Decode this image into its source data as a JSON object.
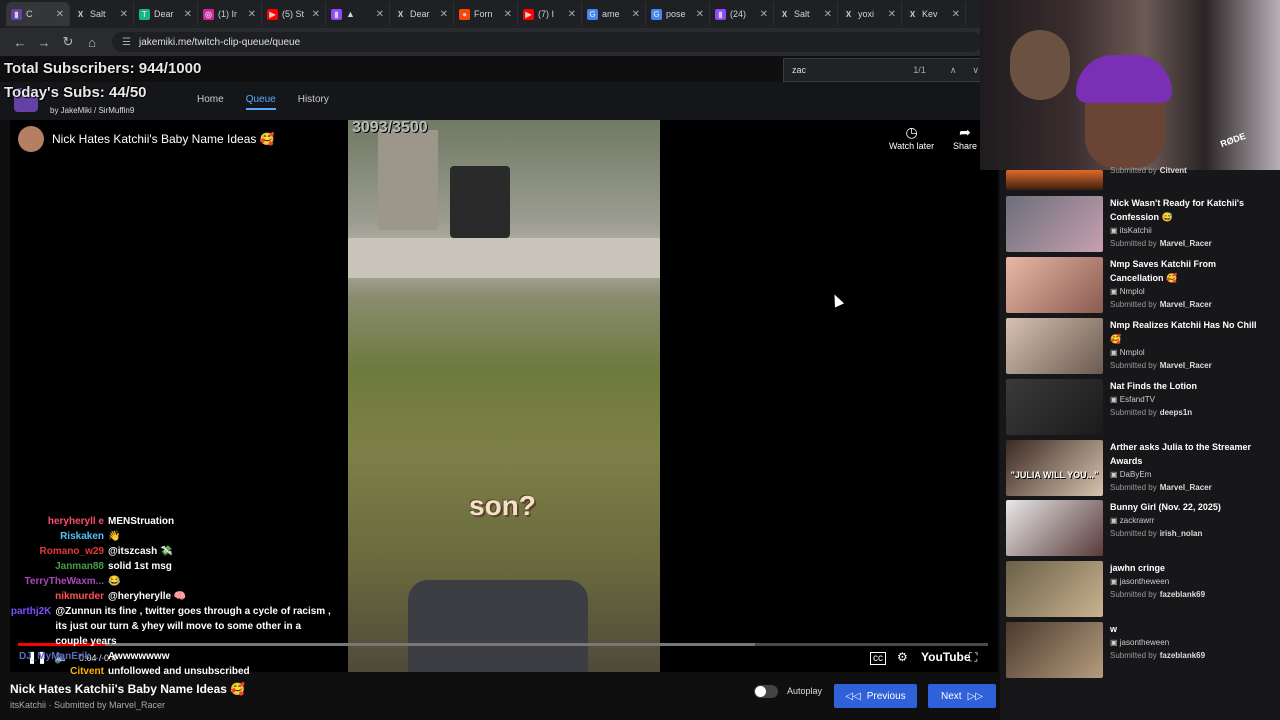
{
  "browser": {
    "tabs": [
      {
        "title": "C",
        "color": "#6441a5",
        "glyph": "▮"
      },
      {
        "title": "Salt",
        "color": "#222",
        "glyph": "X"
      },
      {
        "title": "Dear",
        "color": "#18b585",
        "glyph": "T"
      },
      {
        "title": "(1) Ir",
        "color": "#d6249f",
        "glyph": "◎"
      },
      {
        "title": "(5) St",
        "color": "#ff0000",
        "glyph": "▶"
      },
      {
        "title": "▲",
        "color": "#9146ff",
        "glyph": "▮"
      },
      {
        "title": "Dear",
        "color": "#222",
        "glyph": "X"
      },
      {
        "title": "Forn",
        "color": "#ff4500",
        "glyph": "●"
      },
      {
        "title": "(7) I",
        "color": "#ff0000",
        "glyph": "▶"
      },
      {
        "title": "ame",
        "color": "#4285f4",
        "glyph": "G"
      },
      {
        "title": "pose",
        "color": "#4285f4",
        "glyph": "G"
      },
      {
        "title": "(24)",
        "color": "#9146ff",
        "glyph": "▮"
      },
      {
        "title": "Salt",
        "color": "#222",
        "glyph": "X"
      },
      {
        "title": "yoxi",
        "color": "#222",
        "glyph": "X"
      },
      {
        "title": "Kev",
        "color": "#222",
        "glyph": "X"
      }
    ],
    "url": "jakemiki.me/twitch-clip-queue/queue",
    "find": {
      "query": "zac",
      "count": "1/1"
    }
  },
  "overlay": {
    "total_subs": "Total Subscribers: 944/1000",
    "today_subs": "Today's Subs: 44/50",
    "bits_counter": "3093/3500"
  },
  "site": {
    "credits": "by JakeMiki / SirMuffin9",
    "nav": [
      "Home",
      "Queue",
      "History"
    ],
    "active_nav": "Queue"
  },
  "player": {
    "title": "Nick Hates Katchii's Baby Name Ideas 🥰",
    "watch_later": "Watch later",
    "share": "Share",
    "caption": "son?",
    "time": "0:04 / 0:4",
    "brand": "YouTube",
    "progress_fraction": 0.09
  },
  "chat": [
    {
      "user": "heryheryll e",
      "color": "#ff4d6d",
      "msg": "MENStruation"
    },
    {
      "user": "Riskaken",
      "color": "#4fc3f7",
      "msg": "👋"
    },
    {
      "user": "Romano_w29",
      "color": "#e53935",
      "msg": "@itszcash 💸"
    },
    {
      "user": "Janman88",
      "color": "#43a047",
      "msg": "solid 1st msg"
    },
    {
      "user": "TerryTheWaxm...",
      "color": "#ab47bc",
      "msg": "😂"
    },
    {
      "user": "nikmurder",
      "color": "#ff5252",
      "msg": "@heryherylle 🧠"
    },
    {
      "user": "parthj2K",
      "color": "#7c4dff",
      "msg": "@Zunnun its fine , twitter goes through a cycle of racism , its just our turn & yhey will move to some other in a couple years"
    },
    {
      "user": "DJ_MyManErik_...",
      "color": "#5c6bc0",
      "msg": "Awwwwwww"
    },
    {
      "user": "Citvent",
      "color": "#ffb300",
      "msg": "unfollowed and unsubscribed"
    }
  ],
  "bottom": {
    "title": "Nick Hates Katchii's Baby Name Ideas 🥰",
    "sub": "itsKatchii · Submitted by Marvel_Racer",
    "autoplay": "Autoplay",
    "previous": "Previous",
    "next": "Next"
  },
  "queue": [
    {
      "title": "",
      "channel": "",
      "submitter": "Citvent",
      "thumb": "linear-gradient(#e06a2a,#3a2010)"
    },
    {
      "title": "Nick Wasn't Ready for Katchii's Confession 😅",
      "channel": "itsKatchii",
      "submitter": "Marvel_Racer",
      "thumb": "linear-gradient(135deg,#6b6f7a,#c8a0b0)"
    },
    {
      "title": "Nmp Saves Katchii From Cancellation 🥰",
      "channel": "Nmplol",
      "submitter": "Marvel_Racer",
      "thumb": "linear-gradient(135deg,#e8b7a7,#8a5c50)"
    },
    {
      "title": "Nmp Realizes Katchii Has No Chill 🥰",
      "channel": "Nmplol",
      "submitter": "Marvel_Racer",
      "thumb": "linear-gradient(135deg,#d7c2b2,#6b5a50)"
    },
    {
      "title": "Nat Finds the Lotion",
      "channel": "EsfandTV",
      "submitter": "deeps1n",
      "thumb": "linear-gradient(135deg,#3a3a3a,#1a1a1a)"
    },
    {
      "title": "Arther asks Julia to the Streamer Awards",
      "channel": "DaByEm",
      "submitter": "Marvel_Racer",
      "thumb": "linear-gradient(135deg,#3a2a22,#d9c4b0)",
      "thumb_text": "\"JULIA WILL YOU...\""
    },
    {
      "title": "Bunny Girl (Nov. 22, 2025)",
      "channel": "zackrawrr",
      "submitter": "irish_nolan",
      "thumb": "linear-gradient(135deg,#e8e8e8,#5a3a3a)"
    },
    {
      "title": "jawhn cringe",
      "channel": "jasontheween",
      "submitter": "fazeblank69",
      "thumb": "linear-gradient(135deg,#6a6048,#c9b38f)"
    },
    {
      "title": "w",
      "channel": "jasontheween",
      "submitter": "fazeblank69",
      "thumb": "linear-gradient(135deg,#4a3a2e,#b59c7d)"
    }
  ],
  "labels": {
    "submitted_by": "Submitted by",
    "webcam_brand": "RØDE"
  }
}
